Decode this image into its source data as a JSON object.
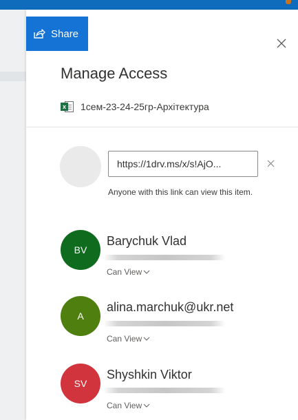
{
  "panel": {
    "share_label": "Share",
    "title": "Manage Access",
    "file_name": "1сем-23-24-25гр-Архітектура",
    "file_icon_letter": "x"
  },
  "link": {
    "url": "https://1drv.ms/x/s!AjO...",
    "description": "Anyone with this link can view this item."
  },
  "people": [
    {
      "initials": "BV",
      "name": "Barychuk Vlad",
      "permission": "Can View",
      "avatar_color": "#0f6b1d"
    },
    {
      "initials": "A",
      "name": "alina.marchuk@ukr.net",
      "permission": "Can View",
      "avatar_color": "#4e7f0f"
    },
    {
      "initials": "SV",
      "name": "Shyshkin Viktor",
      "permission": "Can View",
      "avatar_color": "#d1343d"
    }
  ],
  "colors": {
    "accent": "#1473d4",
    "top_bar": "#0f6cbd"
  },
  "icons": {
    "share": "share-icon",
    "close": "close-icon",
    "remove_link": "remove-link-icon",
    "permission_dropdown": "chevron-down-icon",
    "file": "excel-file-icon"
  }
}
